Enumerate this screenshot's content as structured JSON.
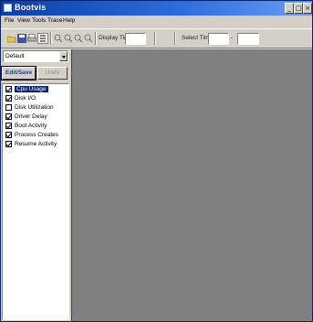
{
  "window": {
    "title": "Bootvis",
    "app_icon": "app-icon"
  },
  "caption_buttons": {
    "minimize": "_",
    "maximize": "□",
    "close": "×"
  },
  "menu": [
    "File",
    "View",
    "Tools",
    "Trace",
    "Help"
  ],
  "toolbar": {
    "display_time_label": "Display Time",
    "display_time_value": "",
    "select_time_label": "Select Time",
    "select_time_from": "",
    "select_time_to": "",
    "icons": [
      "open-icon",
      "save-icon",
      "print-icon",
      "list-icon",
      "zoom-in-icon",
      "zoom-out-icon",
      "zoom-fit-icon",
      "zoom-reset-icon"
    ]
  },
  "left_panel": {
    "preset_value": "Default",
    "edit_save_label": "Edit/Save",
    "undo_label": "Undo",
    "items": [
      {
        "label": "Cpu Usage",
        "checked": true,
        "selected": true
      },
      {
        "label": "Disk I/O",
        "checked": true,
        "selected": false
      },
      {
        "label": "Disk Utilization",
        "checked": false,
        "selected": false
      },
      {
        "label": "Driver Delay",
        "checked": true,
        "selected": false
      },
      {
        "label": "Boot Activity",
        "checked": true,
        "selected": false
      },
      {
        "label": "Process Creates",
        "checked": true,
        "selected": false
      },
      {
        "label": "Resume Activity",
        "checked": true,
        "selected": false
      }
    ]
  },
  "colors": {
    "titlebar": "#0a3ea8",
    "workspace": "#808080",
    "selection": "#0a246a"
  }
}
